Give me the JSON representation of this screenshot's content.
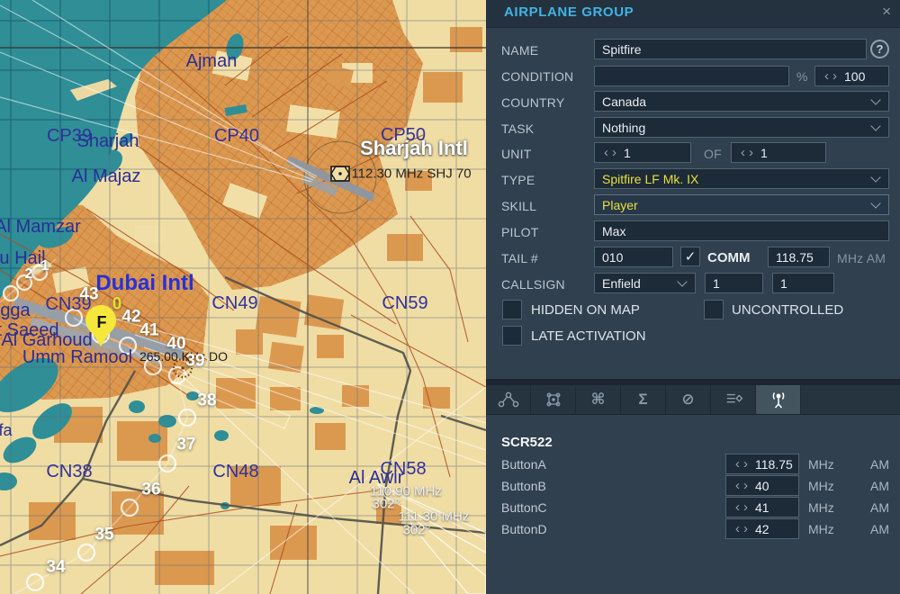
{
  "panel": {
    "title": "AIRPLANE GROUP",
    "close_icon": "×",
    "name": {
      "label": "NAME",
      "value": "Spitfire",
      "help": "?"
    },
    "condition": {
      "label": "CONDITION",
      "value": "",
      "percent": "%",
      "amount": "100"
    },
    "country": {
      "label": "COUNTRY",
      "value": "Canada"
    },
    "task": {
      "label": "TASK",
      "value": "Nothing"
    },
    "unit": {
      "label": "UNIT",
      "count": "1",
      "of": "OF",
      "total": "1"
    },
    "type": {
      "label": "TYPE",
      "value": "Spitfire LF Mk. IX"
    },
    "skill": {
      "label": "SKILL",
      "value": "Player"
    },
    "pilot": {
      "label": "PILOT",
      "value": "Max"
    },
    "tail": {
      "label": "TAIL #",
      "value": "010",
      "check": "✓",
      "comm_label": "COMM",
      "freq": "118.75",
      "units": "MHz AM"
    },
    "callsign": {
      "label": "CALLSIGN",
      "value": "Enfield",
      "flight": "1",
      "number": "1"
    },
    "flags": {
      "hidden_on_map": "HIDDEN ON MAP",
      "uncontrolled": "UNCONTROLLED",
      "late_activation": "LATE ACTIVATION"
    },
    "tabs": [
      {
        "icon": "route-icon"
      },
      {
        "icon": "zone-icon"
      },
      {
        "icon": "actions-icon",
        "glyph": "⌘"
      },
      {
        "icon": "summary-icon",
        "glyph": "Σ"
      },
      {
        "icon": "failures-icon",
        "glyph": "⊘"
      },
      {
        "icon": "payload-icon"
      },
      {
        "icon": "radio-icon",
        "active": true
      }
    ],
    "radio": {
      "title": "SCR522",
      "rows": [
        {
          "label": "ButtonA",
          "value": "118.75",
          "unit": "MHz",
          "mod": "AM"
        },
        {
          "label": "ButtonB",
          "value": "40",
          "unit": "MHz",
          "mod": "AM"
        },
        {
          "label": "ButtonC",
          "value": "41",
          "unit": "MHz",
          "mod": "AM"
        },
        {
          "label": "ButtonD",
          "value": "42",
          "unit": "MHz",
          "mod": "AM"
        }
      ]
    }
  },
  "map": {
    "labels": {
      "ajman": "Ajman",
      "cp39": "CP39",
      "sharjah": "Sharjah",
      "cp40": "CP40",
      "cp50": "CP50",
      "sharjah_intl": "Sharjah Intl",
      "sharjah_vor": "112.30 MHz SHJ 70",
      "al_majaz": "Al Majaz",
      "al_mamzar": "Al Mamzar",
      "abu_hail": "u Hail",
      "dubai_intl": "Dubai Intl",
      "cn39": "CN39",
      "cn49": "CN49",
      "cn59": "CN59",
      "rigga": "gga",
      "saeed": "t Saeed",
      "al_garhoud": "Al Garhoud",
      "umm_ramool": "Umm Ramool",
      "dubai_ndb": "265.00 KHz DO",
      "cn38": "CN38",
      "cn48": "CN48",
      "cn58": "CN58",
      "al_awir": "Al Awir",
      "ils1_freq": "110.90 MHz",
      "ils1_crs": "302°",
      "ils2_freq": "111.30 MHz",
      "ils2_crs": "302°",
      "edge_west": "fa"
    },
    "waypoints": {
      "current": "0",
      "w1": "1",
      "w2": "2",
      "w34": "34",
      "w35": "35",
      "w36": "36",
      "w37": "37",
      "w38": "38",
      "w39": "39",
      "w40": "40",
      "w41": "41",
      "w42": "42",
      "w43": "43"
    },
    "marker": {
      "group_letter": "F"
    },
    "colors": {
      "sea": "#2f8e96",
      "urban": "#db9950",
      "terrain": "#f0dda4",
      "panel_accent": "#41b4e4",
      "selection_yellow": "#e8df2e",
      "label_navy": "#2b2e96"
    }
  }
}
